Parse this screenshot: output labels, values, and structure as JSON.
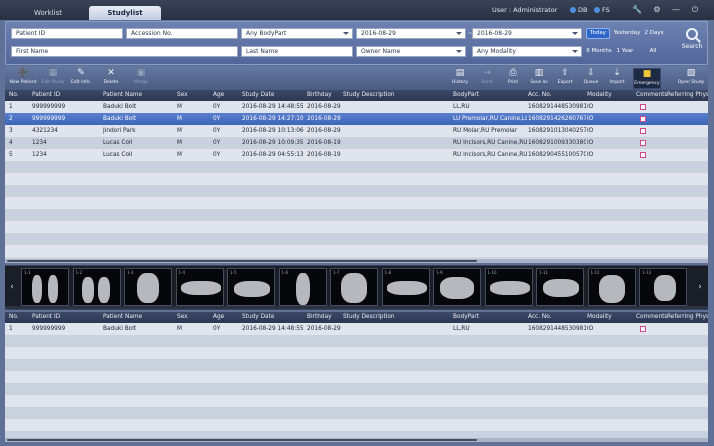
{
  "tabs": {
    "worklist": "Worklist",
    "studylist": "Studylist"
  },
  "status": {
    "user": "User :  Administrator",
    "db": "DB",
    "fs": "FS"
  },
  "search": {
    "patient_id": "Patient ID",
    "accession": "Accession No.",
    "bodypart": "Any BodyPart",
    "date_from": "2016-08-29",
    "date_to": "2016-08-29",
    "first_name": "First Name",
    "last_name": "Last Name",
    "owner_name": "Owner Name",
    "modality": "Any Modality",
    "dash": "~",
    "quick": {
      "today": "Today",
      "yesterday": "Yesterday",
      "two_days": "2 Days",
      "six_months": "6 Months",
      "one_year": "1 Year",
      "all": "All"
    },
    "search_button": "Search"
  },
  "toolbar": {
    "new_patient": "New Patient",
    "edit_study": "Edit Study",
    "edit_info": "Edit Info.",
    "delete": "Delete",
    "merge": "Merge",
    "history": "History",
    "send": "Send",
    "print": "Print",
    "save_as": "Save as",
    "export": "Export",
    "queue": "Queue",
    "import": "Import",
    "emergency": "Emergency",
    "open_study": "Open Study"
  },
  "columns": [
    "No.",
    "Patient ID",
    "Patient Name",
    "Sex",
    "Age",
    "Study Date",
    "Birthday",
    "Study Description",
    "BodyPart",
    "Acc. No.",
    "Modality",
    "Comments",
    "Referring Phys"
  ],
  "study_rows": [
    [
      "1",
      "999999999",
      "Baduki  Bolt",
      "M",
      "0Y",
      "2016-08-29 14:48:55",
      "2016-08-29",
      "",
      "LL,RU",
      "1608291448530981",
      "IO"
    ],
    [
      "2",
      "999999999",
      "Baduki  Bolt",
      "M",
      "0Y",
      "2016-08-29 14:27:10",
      "2016-08-29",
      "",
      "LU Premolar,RU Canine,LL",
      "1608291426260767",
      "IO"
    ],
    [
      "3",
      "4321234",
      "Jindori  Park",
      "M",
      "0Y",
      "2016-08-29 10:13:06",
      "2016-08-29",
      "",
      "RU Molar,RU Premolar",
      "1608291013040257",
      "IO"
    ],
    [
      "4",
      "1234",
      "Lucas  Coll",
      "M",
      "0Y",
      "2016-08-29 10:09:35",
      "2016-08-19",
      "",
      "RU Incisors,RU Canine,RU",
      "1608291009330380",
      "IO"
    ],
    [
      "5",
      "1234",
      "Lucas  Coll",
      "M",
      "0Y",
      "2016-08-29 04:55:13",
      "2016-08-19",
      "",
      "RU Incisors,RU Canine,RU",
      "1608290455100570",
      "IO"
    ]
  ],
  "selected_row": 2,
  "history_rows": [
    [
      "1",
      "999999999",
      "Baduki  Bolt",
      "M",
      "0Y",
      "2016-08-29 14:48:55",
      "2016-08-29",
      "",
      "LL,RU",
      "1608291448530981",
      "IO"
    ]
  ],
  "thumbnails": [
    "1-1",
    "1-2",
    "1-3",
    "1-4",
    "1-5",
    "1-6",
    "1-7",
    "1-8",
    "1-9",
    "1-10",
    "1-11",
    "1-12",
    "1-13"
  ],
  "icons": {
    "prev": "chevron-left-icon",
    "next": "chevron-right-icon"
  },
  "colors": {
    "accent": "#2f66c9",
    "selected_row": "#3c64b8",
    "emergency": "#f0c63a",
    "comment_box": "#d24a8a"
  }
}
